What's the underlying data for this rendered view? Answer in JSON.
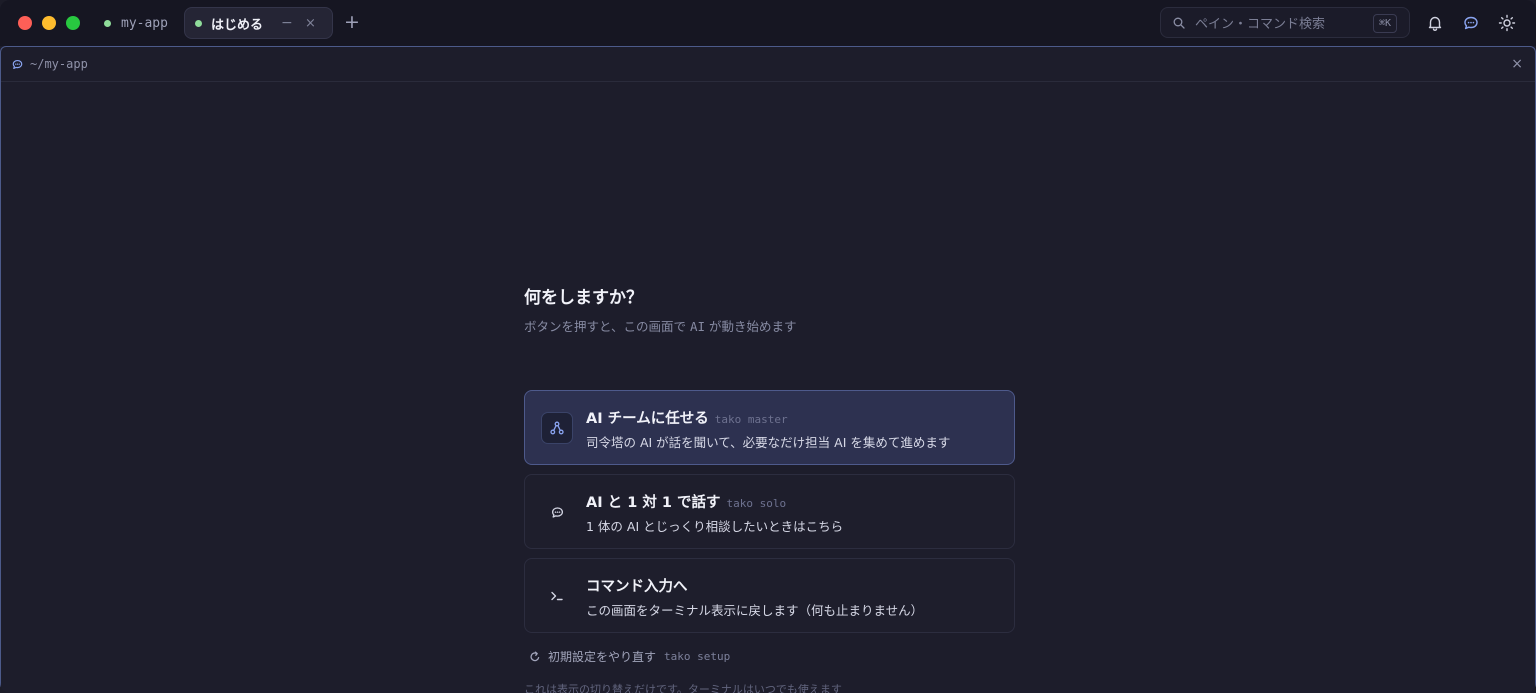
{
  "tabs": [
    {
      "label": "my-app",
      "active": false
    },
    {
      "label": "はじめる",
      "active": true
    }
  ],
  "tab_controls": {
    "minimize": "−",
    "close": "×",
    "new": "+"
  },
  "search": {
    "placeholder": "ペイン・コマンド検索",
    "shortcut": "⌘K"
  },
  "toolbar_icons": [
    "bell-icon",
    "chat-icon",
    "sun-icon"
  ],
  "pane": {
    "path": "~/my-app",
    "close": "×"
  },
  "prompt": {
    "title": "何をしますか？",
    "subtitle_pre": "ボタンを押すと、この画面で",
    "subtitle_ai": "AI",
    "subtitle_post": "が動き始めます"
  },
  "cards": [
    {
      "title": "AI チームに任せる",
      "command": "tako master",
      "description": "司令塔の AI が話を聞いて、必要なだけ担当 AI を集めて進めます",
      "icon": "team-icon",
      "active": true
    },
    {
      "title": "AI と 1 対 1 で話す",
      "command": "tako solo",
      "description": "1 体の AI とじっくり相談したいときはこちら",
      "icon": "chat-icon",
      "active": false
    },
    {
      "title": "コマンド入力へ",
      "command": "",
      "description": "この画面をターミナル表示に戻します（何も止まりません）",
      "icon": "terminal-icon",
      "active": false
    }
  ],
  "reset": {
    "label": "初期設定をやり直す",
    "command": "tako setup"
  },
  "note": "これは表示の切り替えだけです。ターミナルはいつでも使えます",
  "colors": {
    "accent": "#4e5a8c",
    "status_dot": "#8fdc9a",
    "background": "#1d1d2b"
  }
}
